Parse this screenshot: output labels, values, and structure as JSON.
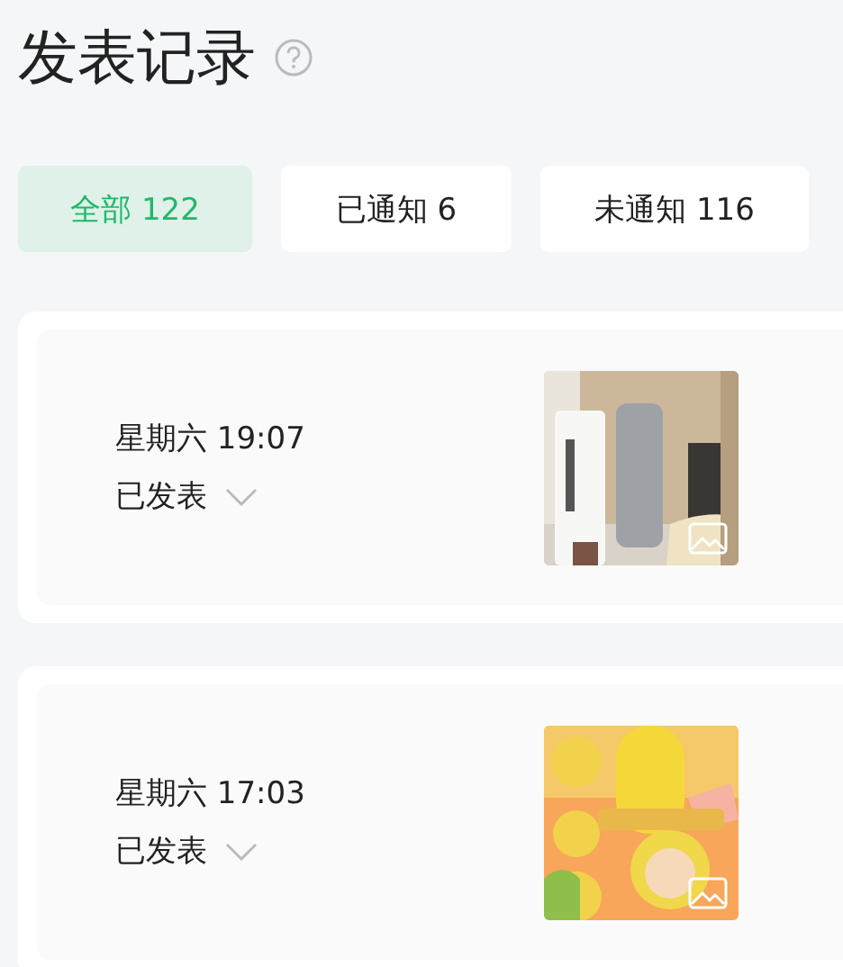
{
  "title": "发表记录",
  "tabs": [
    {
      "label": "全部 122",
      "selected": true
    },
    {
      "label": "已通知 6",
      "selected": false
    },
    {
      "label": "未通知 116",
      "selected": false
    }
  ],
  "posts": [
    {
      "time": "星期六 19:07",
      "status": "已发表"
    },
    {
      "time": "星期六 17:03",
      "status": "已发表"
    }
  ]
}
